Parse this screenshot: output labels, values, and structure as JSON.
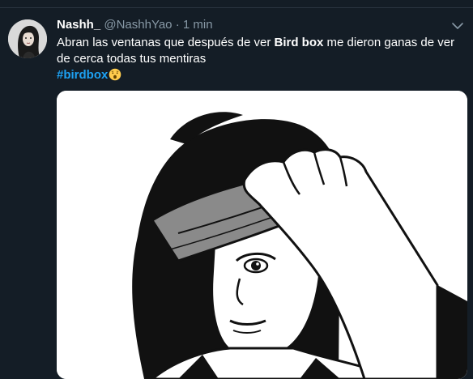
{
  "tweet": {
    "author_name": "Nashh_",
    "handle": "@NashhYao",
    "separator": "·",
    "time": "1 min",
    "text_part1": "Abran las ventanas que después de ver ",
    "text_bold": "Bird box",
    "text_part2": " me dieron ganas de ver de cerca todas tus mentiras",
    "hashtag": "#birdbox",
    "emoji": "face-with-open-mouth-emoji"
  },
  "colors": {
    "background": "#141d26",
    "text": "#ffffff",
    "secondary_text": "#8899a6",
    "link": "#1da1f2"
  },
  "icons": {
    "menu": "chevron-down-icon"
  }
}
